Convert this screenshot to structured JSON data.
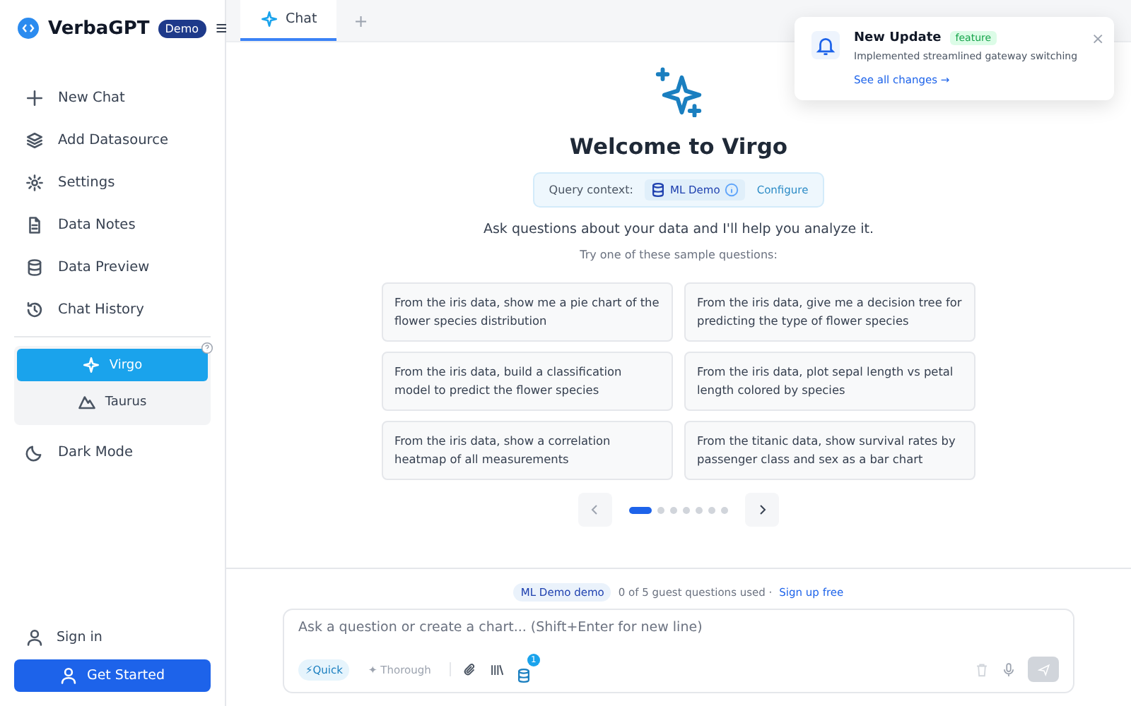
{
  "brand": {
    "name": "VerbaGPT",
    "badge": "Demo"
  },
  "nav": [
    "New Chat",
    "Add Datasource",
    "Settings",
    "Data Notes",
    "Data Preview",
    "Chat History"
  ],
  "modes": [
    {
      "label": "Virgo",
      "selected": true
    },
    {
      "label": "Taurus",
      "selected": false
    }
  ],
  "dark_mode": "Dark Mode",
  "sign_in": "Sign in",
  "get_started": "Get Started",
  "tabs": [
    {
      "label": "Chat",
      "selected": true
    }
  ],
  "add_tab": "+",
  "notification": {
    "title": "New Update",
    "tag": "feature",
    "message": "Implemented streamlined gateway switching",
    "link": "See all changes →",
    "close": "×"
  },
  "welcome": {
    "title": "Welcome to Virgo",
    "context_label": "Query context:",
    "context_value": "ML Demo",
    "configure": "Configure",
    "subtitle": "Ask questions about your data and I'll help you analyze it.",
    "hint": "Try one of these sample questions:"
  },
  "samples": [
    "From the iris data, show me a pie chart of the flower species distribution",
    "From the iris data, give me a decision tree for predicting the type of flower species",
    "From the iris data, build a classification model to predict the flower species",
    "From the iris data, plot sepal length vs petal length colored by species",
    "From the iris data, show a correlation heatmap of all measurements",
    "From the titanic data, show survival rates by passenger class and sex as a bar chart"
  ],
  "pages": [
    {
      "selected": true
    },
    {
      "selected": false
    },
    {
      "selected": false
    },
    {
      "selected": false
    },
    {
      "selected": false
    },
    {
      "selected": false
    },
    {
      "selected": false
    }
  ],
  "usage": {
    "source": "ML Demo demo",
    "text": "0 of 5 guest questions used ·",
    "link": "Sign up free"
  },
  "composer": {
    "placeholder": "Ask a question or create a chart... (Shift+Enter for new line)",
    "speeds": [
      {
        "label": "⚡Quick",
        "selected": true
      },
      {
        "label": "✦ Thorough",
        "selected": false
      }
    ],
    "datasource_count": "1"
  }
}
